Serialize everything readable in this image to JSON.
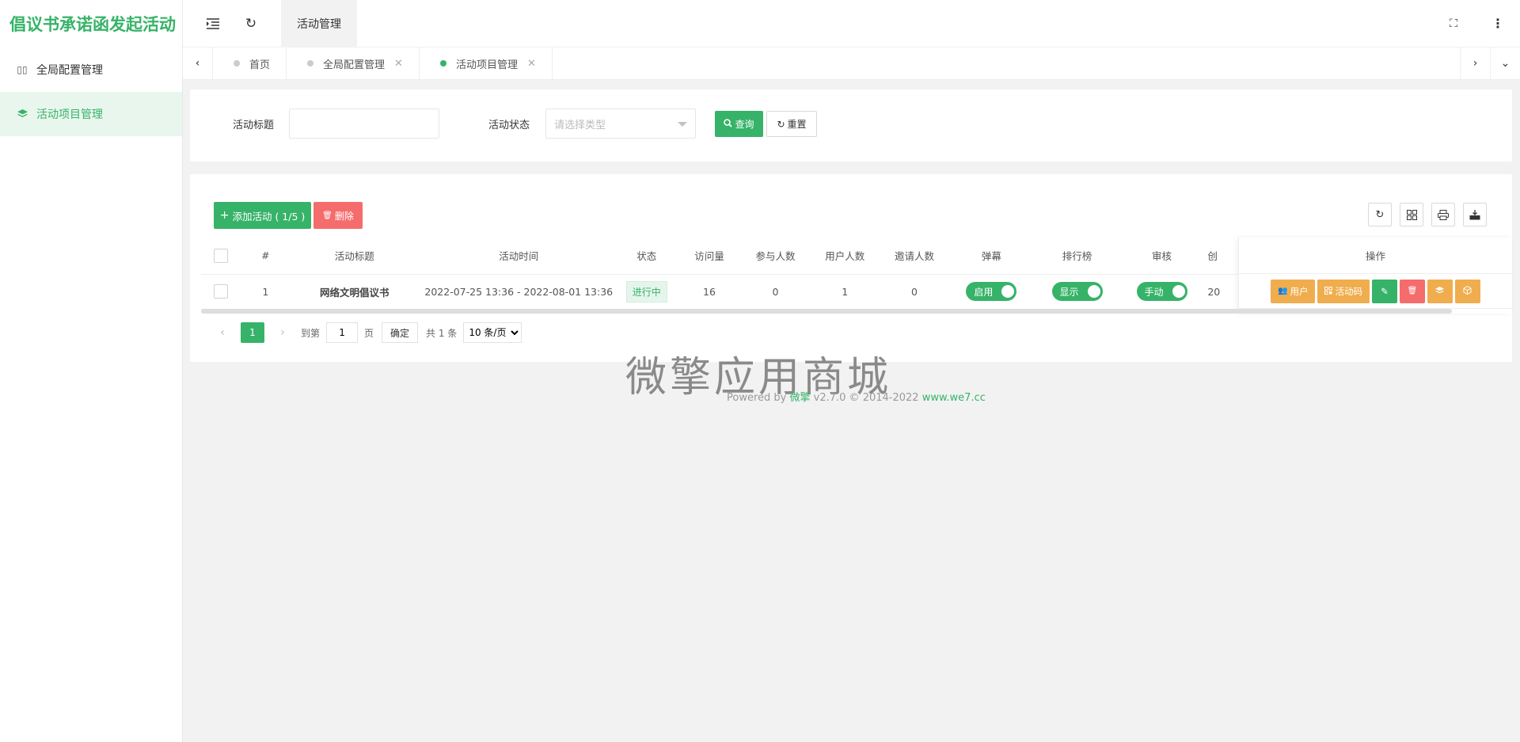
{
  "app": {
    "title": "倡议书承诺函发起活动"
  },
  "sidebar": {
    "items": [
      {
        "label": "全局配置管理",
        "icon": "columns-icon",
        "active": false
      },
      {
        "label": "活动项目管理",
        "icon": "layers-icon",
        "active": true
      }
    ]
  },
  "header": {
    "title": "活动管理",
    "icons": [
      "menu-collapse-icon",
      "refresh-icon",
      "fullscreen-icon",
      "more-vertical-icon"
    ]
  },
  "tabs": [
    {
      "label": "首页",
      "closable": false,
      "active": false
    },
    {
      "label": "全局配置管理",
      "closable": true,
      "active": false
    },
    {
      "label": "活动项目管理",
      "closable": true,
      "active": true
    }
  ],
  "search": {
    "title_label": "活动标题",
    "title_value": "",
    "status_label": "活动状态",
    "status_placeholder": "请选择类型",
    "query_button": "查询",
    "reset_button": "重置"
  },
  "toolbar": {
    "add_button": "添加活动 ( 1/5 )",
    "delete_button": "删除"
  },
  "table": {
    "columns": [
      "#",
      "活动标题",
      "活动时间",
      "状态",
      "访问量",
      "参与人数",
      "用户人数",
      "邀请人数",
      "弹幕",
      "排行榜",
      "审核",
      "创"
    ],
    "rows": [
      {
        "index": "1",
        "title": "网络文明倡议书",
        "time": "2022-07-25 13:36 - 2022-08-01 13:36",
        "status": "进行中",
        "visits": "16",
        "participants": "0",
        "users": "1",
        "invites": "0",
        "danmaku": "启用",
        "ranking": "显示",
        "review": "手动",
        "created_partial": "20"
      }
    ],
    "ops_header": "操作",
    "ops_buttons": {
      "users": "用户",
      "qrcode": "活动码"
    }
  },
  "pagination": {
    "current_page": "1",
    "goto_label": "到第",
    "goto_value": "1",
    "page_unit": "页",
    "confirm": "确定",
    "total": "共 1 条",
    "page_size": "10 条/页"
  },
  "watermark": "微擎应用商城",
  "footer": {
    "powered": "Powered by",
    "brand": "微擎",
    "version": "v2.7.0 © 2014-2022",
    "site": "www.we7.cc"
  },
  "colors": {
    "accent": "#36b368",
    "danger": "#f56c6c",
    "warning": "#f0ad4e"
  }
}
